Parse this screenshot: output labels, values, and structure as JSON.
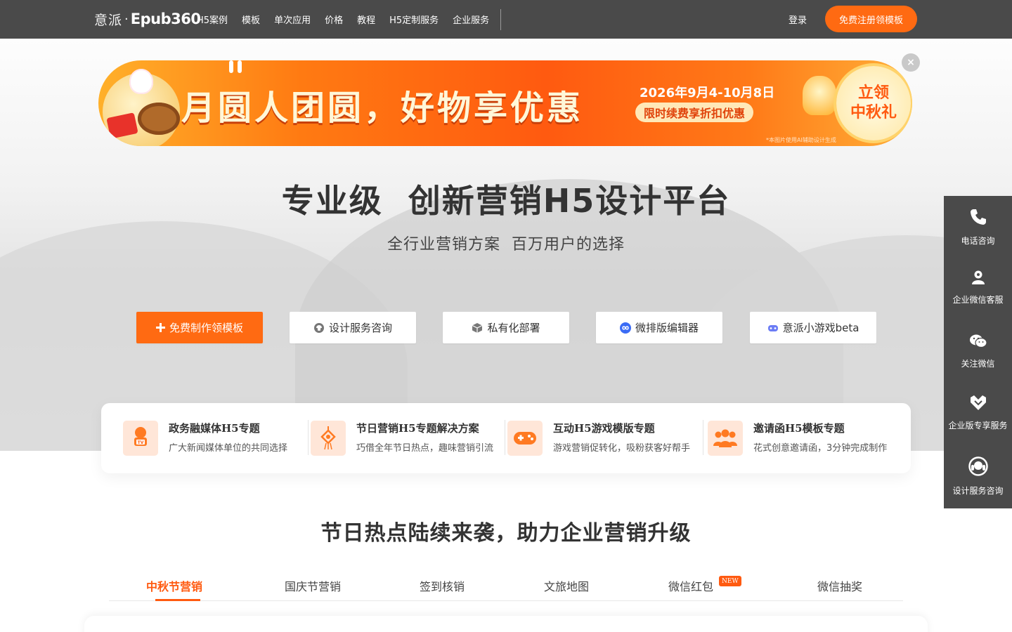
{
  "header": {
    "logo_cn": "意派",
    "logo_dot": "·",
    "logo_en": "Epub360",
    "nav": [
      "H5案例",
      "模板",
      "单次应用",
      "价格",
      "教程",
      "H5定制服务",
      "企业服务"
    ],
    "login": "登录",
    "register": "免费注册领模板"
  },
  "banner": {
    "title": "月圆人团圆，好物享优惠",
    "date": "2026年9月4-10月8日",
    "promo": "限时续费享折扣优惠",
    "badge_line1": "立领",
    "badge_line2": "中秋礼",
    "note": "*本图片使用AI辅助设计生成",
    "close": "×"
  },
  "hero": {
    "title": "专业级  创新营销H5设计平台",
    "subtitle": "全行业营销方案  百万用户的选择"
  },
  "cta": [
    {
      "label": "免费制作领模板",
      "icon": "plus-icon"
    },
    {
      "label": "设计服务咨询",
      "icon": "headset-icon"
    },
    {
      "label": "私有化部署",
      "icon": "cube-icon"
    },
    {
      "label": "微排版编辑器",
      "icon": "infinity-icon"
    },
    {
      "label": "意派小游戏beta",
      "icon": "gamepad-icon"
    }
  ],
  "features": [
    {
      "title": "政务融媒体H5专题",
      "desc": "广大新闻媒体单位的共同选择",
      "icon": "tv-person-icon"
    },
    {
      "title": "节日营销H5专题解决方案",
      "desc": "巧借全年节日热点，趣味营销引流",
      "icon": "chinese-knot-icon"
    },
    {
      "title": "互动H5游戏模版专题",
      "desc": "游戏营销促转化，吸粉获客好帮手",
      "icon": "gamepad-icon"
    },
    {
      "title": "邀请函H5模板专题",
      "desc": "花式创意邀请函，3分钟完成制作",
      "icon": "group-icon"
    }
  ],
  "section": {
    "title": "节日热点陆续来袭，助力企业营销升级",
    "tabs": [
      "中秋节营销",
      "国庆节营销",
      "签到核销",
      "文旅地图",
      "微信红包",
      "微信抽奖"
    ],
    "active_tab": 0,
    "new_badge": "NEW"
  },
  "side": [
    {
      "label": "电话咨询",
      "icon": "phone-icon"
    },
    {
      "label": "企业微信客服",
      "icon": "wecom-icon"
    },
    {
      "label": "关注微信",
      "icon": "wechat-icon"
    },
    {
      "label": "企业版专享服务",
      "icon": "diamond-icon"
    },
    {
      "label": "设计服务咨询",
      "icon": "headset-icon"
    }
  ],
  "colors": {
    "accent": "#ff6a12",
    "dark": "#4a4a4a"
  }
}
